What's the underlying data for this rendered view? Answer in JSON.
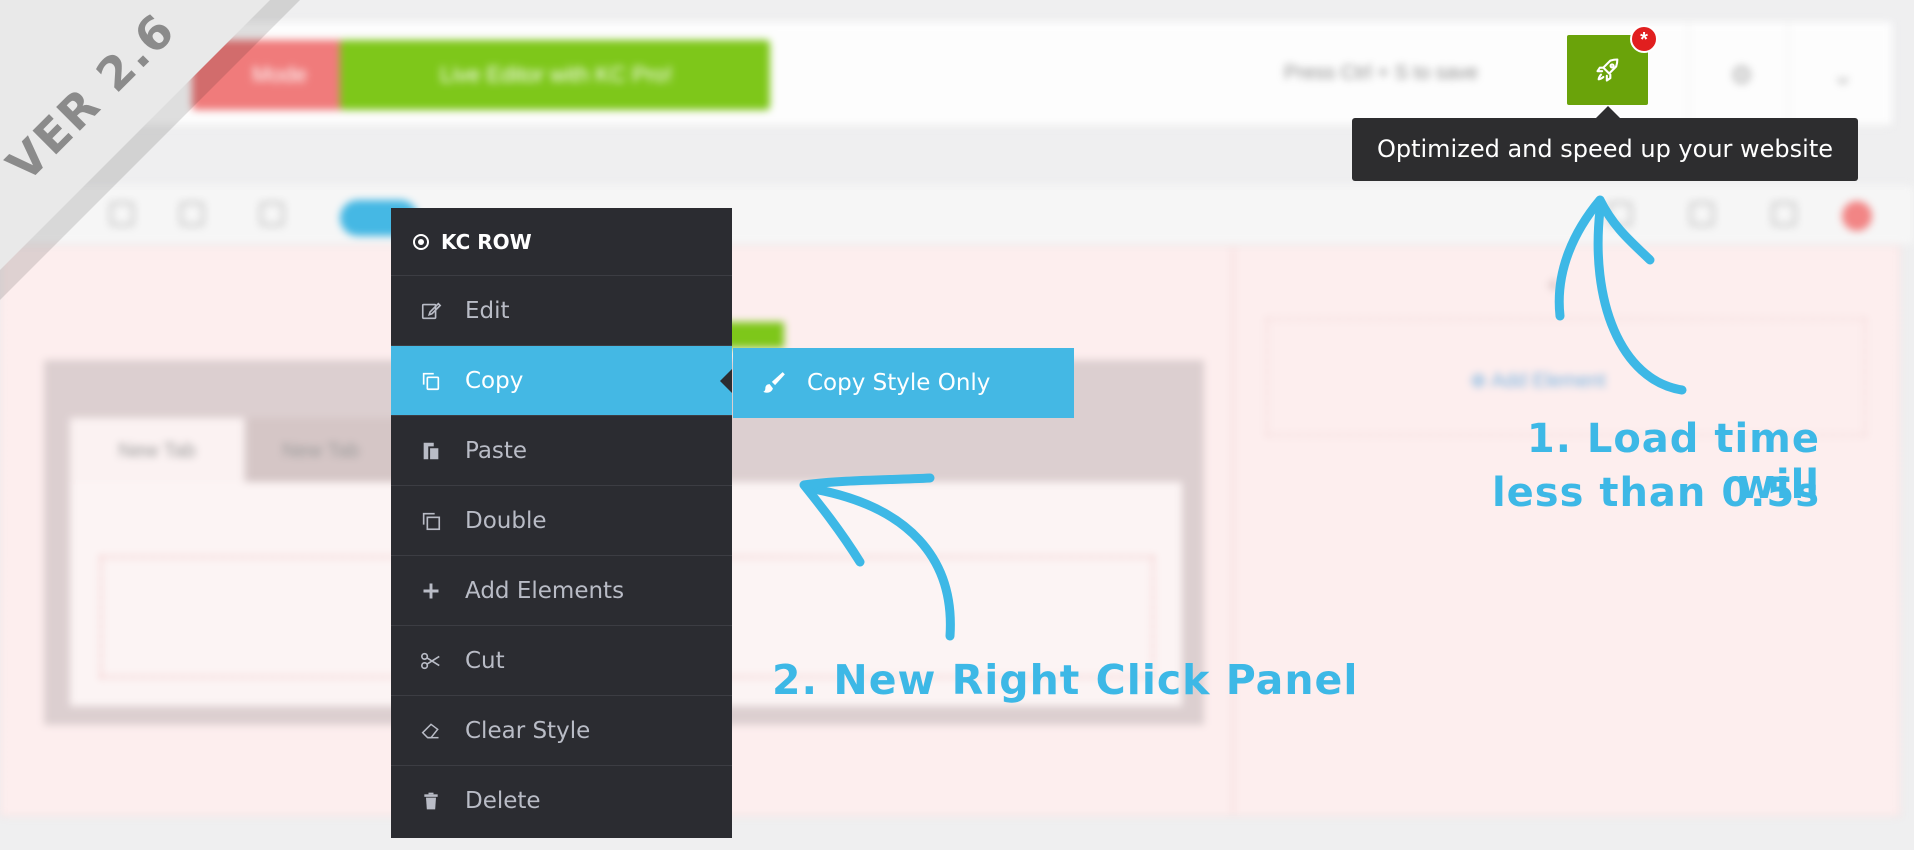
{
  "version_ribbon": "VER 2.6",
  "toolbar": {
    "mode_button": "Mode",
    "live_editor_button": "Live Editor with KC Pro!",
    "save_hint": "Press Ctrl + S to save",
    "rocket_badge": "*",
    "rocket_tooltip": "Optimized and speed up your website"
  },
  "canvas": {
    "tab_1": "New Tab",
    "tab_2": "New Tab",
    "add_element": "Add Element"
  },
  "context_menu": {
    "title": "KC ROW",
    "items": [
      {
        "label": "Edit",
        "icon": "edit-icon"
      },
      {
        "label": "Copy",
        "icon": "copy-icon",
        "active": true
      },
      {
        "label": "Paste",
        "icon": "paste-icon"
      },
      {
        "label": "Double",
        "icon": "double-icon"
      },
      {
        "label": "Add Elements",
        "icon": "plus-icon"
      },
      {
        "label": "Cut",
        "icon": "scissors-icon"
      },
      {
        "label": "Clear Style",
        "icon": "eraser-icon"
      },
      {
        "label": "Delete",
        "icon": "trash-icon"
      }
    ],
    "submenu": {
      "label": "Copy Style Only",
      "icon": "brush-icon"
    }
  },
  "annotations": {
    "note_1_line_1": "1. Load time will",
    "note_1_line_2": "less than 0.5s",
    "note_2": "2. New Right Click Panel"
  },
  "colors": {
    "accent_blue": "#44b8e4",
    "menu_bg": "#2b2c31",
    "rocket_green": "#6aa30a",
    "badge_red": "#e11f1f",
    "tooltip_bg": "#2d2d2f"
  }
}
